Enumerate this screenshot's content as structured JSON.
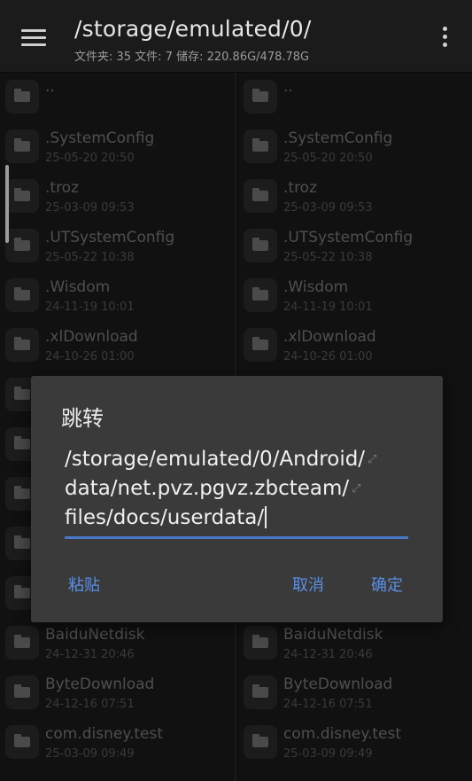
{
  "header": {
    "path": "/storage/emulated/0/",
    "stats": "文件夹: 35   文件: 7   储存: 220.86G/478.78G"
  },
  "panes": {
    "left": [
      {
        "name": "..",
        "date": ""
      },
      {
        "name": ".SystemConfig",
        "date": "25-05-20 20:50"
      },
      {
        "name": ".troz",
        "date": "25-03-09 09:53"
      },
      {
        "name": ".UTSystemConfig",
        "date": "25-05-22 10:38"
      },
      {
        "name": ".Wisdom",
        "date": "24-11-19 10:01"
      },
      {
        "name": ".xlDownload",
        "date": "24-10-26 01:00"
      },
      {
        "name": "",
        "date": ""
      },
      {
        "name": "",
        "date": ""
      },
      {
        "name": "",
        "date": ""
      },
      {
        "name": "",
        "date": ""
      },
      {
        "name": "",
        "date": ""
      },
      {
        "name": "BaiduNetdisk",
        "date": "24-12-31 20:46"
      },
      {
        "name": "ByteDownload",
        "date": "24-12-16 07:51"
      },
      {
        "name": "com.disney.test",
        "date": "25-03-09 09:49"
      }
    ],
    "right": [
      {
        "name": "..",
        "date": ""
      },
      {
        "name": ".SystemConfig",
        "date": "25-05-20 20:50"
      },
      {
        "name": ".troz",
        "date": "25-03-09 09:53"
      },
      {
        "name": ".UTSystemConfig",
        "date": "25-05-22 10:38"
      },
      {
        "name": ".Wisdom",
        "date": "24-11-19 10:01"
      },
      {
        "name": ".xlDownload",
        "date": "24-10-26 01:00"
      },
      {
        "name": "",
        "date": ""
      },
      {
        "name": "",
        "date": ""
      },
      {
        "name": "",
        "date": ""
      },
      {
        "name": "",
        "date": ""
      },
      {
        "name": "",
        "date": ""
      },
      {
        "name": "BaiduNetdisk",
        "date": "24-12-31 20:46"
      },
      {
        "name": "ByteDownload",
        "date": "24-12-16 07:51"
      },
      {
        "name": "com.disney.test",
        "date": "25-03-09 09:49"
      }
    ]
  },
  "dialog": {
    "title": "跳转",
    "path_lines": [
      "/storage/emulated/0/Android/",
      "data/net.pvz.pgvz.zbcteam/",
      "files/docs/userdata/"
    ],
    "paste_label": "粘贴",
    "cancel_label": "取消",
    "ok_label": "确定",
    "accent_color": "#5b8fe0"
  },
  "icons": [
    "menu-icon",
    "more-vert-icon",
    "folder-icon",
    "line-wrap-icon"
  ]
}
